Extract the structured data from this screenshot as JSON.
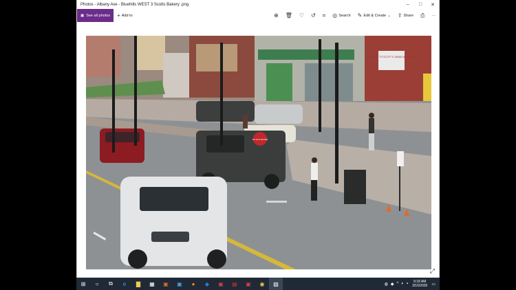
{
  "window": {
    "title": "Photos - Albany Ave - Bluehills WEST 3 Scotts Bakery .png",
    "minimize": "–",
    "maximize": "□",
    "close": "✕"
  },
  "toolbar": {
    "see_all_label": "See all photos",
    "add_to_label": "Add to",
    "search_label": "Search",
    "edit_create_label": "Edit & Create",
    "share_label": "Share",
    "more_label": "···"
  },
  "photo": {
    "sign_stop_text": "DO NOT ENTER",
    "bakery_sign": "WELCOME TO SCOTT'S JAMAICAN BAKERY"
  },
  "taskbar": {
    "time": "9:18 AM",
    "date": "3/10/2020"
  },
  "colors": {
    "accent": "#6b2c8a",
    "taskbar": "#1f2a36"
  }
}
